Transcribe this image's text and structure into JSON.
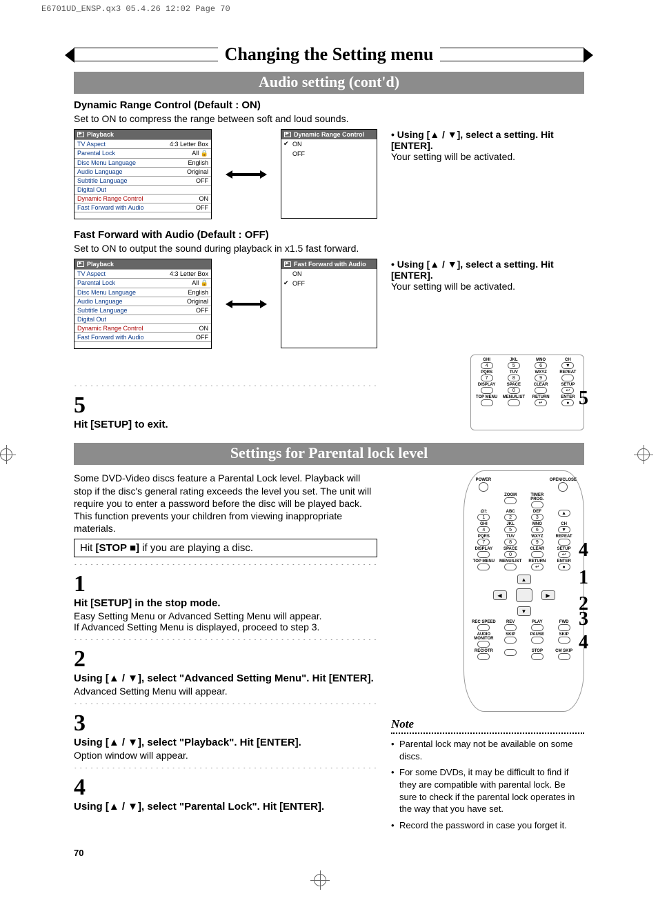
{
  "meta": {
    "header": "E6701UD_ENSP.qx3  05.4.26 12:02  Page 70"
  },
  "title": "Changing the Setting menu",
  "section1": {
    "bar": "Audio setting (cont'd)",
    "drc": {
      "heading": "Dynamic Range Control (Default : ON)",
      "desc": "Set to ON to compress the range between soft and loud sounds.",
      "menuTitle1": "Playback",
      "rows": [
        {
          "label": "TV Aspect",
          "value": "4:3 Letter Box",
          "hl": false
        },
        {
          "label": "Parental Lock",
          "value": "All  🔒",
          "hl": false
        },
        {
          "label": "Disc Menu Language",
          "value": "English",
          "hl": false
        },
        {
          "label": "Audio Language",
          "value": "Original",
          "hl": false
        },
        {
          "label": "Subtitle Language",
          "value": "OFF",
          "hl": false
        },
        {
          "label": "Digital Out",
          "value": "",
          "hl": false
        },
        {
          "label": "Dynamic Range Control",
          "value": "ON",
          "hl": true
        },
        {
          "label": "Fast Forward with Audio",
          "value": "OFF",
          "hl": false
        }
      ],
      "menuTitle2": "Dynamic Range Control",
      "options": [
        {
          "label": "ON",
          "checked": true
        },
        {
          "label": "OFF",
          "checked": false
        }
      ],
      "note1": "Using [▲ / ▼], select a setting. Hit [ENTER].",
      "note2": "Your setting will be activated."
    },
    "ffa": {
      "heading": "Fast Forward with Audio (Default : OFF)",
      "desc": "Set to ON to output the sound during playback in x1.5 fast forward.",
      "menuTitle1": "Playback",
      "rows": [
        {
          "label": "TV Aspect",
          "value": "4:3 Letter Box",
          "hl": false
        },
        {
          "label": "Parental Lock",
          "value": "All  🔒",
          "hl": false
        },
        {
          "label": "Disc Menu Language",
          "value": "English",
          "hl": false
        },
        {
          "label": "Audio Language",
          "value": "Original",
          "hl": false
        },
        {
          "label": "Subtitle Language",
          "value": "OFF",
          "hl": false
        },
        {
          "label": "Digital Out",
          "value": "",
          "hl": false
        },
        {
          "label": "Dynamic Range Control",
          "value": "ON",
          "hl": true
        },
        {
          "label": "Fast Forward with Audio",
          "value": "OFF",
          "hl": false
        }
      ],
      "menuTitle2": "Fast Forward with Audio",
      "options": [
        {
          "label": "ON",
          "checked": false
        },
        {
          "label": "OFF",
          "checked": true
        }
      ],
      "note1": "Using [▲ / ▼], select a setting. Hit [ENTER].",
      "note2": "Your setting will be activated."
    },
    "step5num": "5",
    "step5text": "Hit [SETUP] to exit.",
    "remoteCallout5": "5"
  },
  "section2": {
    "bar": "Settings for Parental lock level",
    "intro": "Some DVD-Video discs feature a Parental Lock level. Playback will stop if the disc's general rating exceeds the level you set. The unit will require you to enter a password before the disc will be played back. This function prevents your children from viewing inappropriate materials.",
    "boxInstrPrefix": "Hit ",
    "boxInstrBold": "[STOP ■]",
    "boxInstrSuffix": " if you are playing a disc.",
    "steps": [
      {
        "num": "1",
        "head": "Hit [SETUP] in the stop mode.",
        "body": "Easy Setting Menu or Advanced Setting Menu will appear.\nIf Advanced Setting Menu is displayed, proceed to step 3."
      },
      {
        "num": "2",
        "head": "Using [▲ / ▼], select \"Advanced Setting Menu\". Hit [ENTER].",
        "body": "Advanced Setting Menu will appear."
      },
      {
        "num": "3",
        "head": "Using [▲ / ▼], select \"Playback\". Hit [ENTER].",
        "body": "Option window will appear."
      },
      {
        "num": "4",
        "head": "Using [▲ / ▼], select \"Parental Lock\". Hit [ENTER].",
        "body": ""
      }
    ],
    "remoteCallouts": [
      "4",
      "1",
      "2",
      "3",
      "4"
    ],
    "noteHead": "Note",
    "notes": [
      "Parental lock may not be available on some discs.",
      "For some DVDs, it may be difficult to find if they are compatible with parental lock. Be sure to check if the parental lock operates in the way that you have set.",
      "Record the password in case you forget it."
    ]
  },
  "remoteSmall": {
    "row1": [
      "GHI",
      "JKL",
      "MNO",
      "CH"
    ],
    "btn1": [
      "4",
      "5",
      "6",
      "▼"
    ],
    "row2": [
      "PQRS",
      "TUV",
      "WXYZ",
      "REPEAT"
    ],
    "btn2": [
      "7",
      "8",
      "9",
      ""
    ],
    "row3": [
      "DISPLAY",
      "SPACE",
      "CLEAR",
      "SETUP"
    ],
    "btn3": [
      "",
      "0",
      "",
      "↩"
    ],
    "row4": [
      "TOP MENU",
      "MENU/LIST",
      "RETURN",
      "ENTER"
    ],
    "btn4": [
      "",
      "",
      "↵",
      "●"
    ]
  },
  "remoteBig": {
    "topRow": [
      "POWER",
      "",
      "",
      "OPEN/CLOSE"
    ],
    "topRow2": [
      "",
      "ZOOM",
      "TIMER PROG.",
      ""
    ],
    "numRows": [
      {
        "labels": [
          "@!:",
          "ABC",
          "DEF",
          ""
        ],
        "nums": [
          "1",
          "2",
          "3",
          "▲"
        ]
      },
      {
        "labels": [
          "GHI",
          "JKL",
          "MNO",
          "CH"
        ],
        "nums": [
          "4",
          "5",
          "6",
          "▼"
        ]
      },
      {
        "labels": [
          "PQRS",
          "TUV",
          "WXYZ",
          "REPEAT"
        ],
        "nums": [
          "7",
          "8",
          "9",
          ""
        ]
      },
      {
        "labels": [
          "DISPLAY",
          "SPACE",
          "CLEAR",
          "SETUP"
        ],
        "nums": [
          "",
          "0",
          "",
          "↩"
        ]
      },
      {
        "labels": [
          "TOP MENU",
          "MENU/LIST",
          "RETURN",
          "ENTER"
        ],
        "nums": [
          "",
          "",
          "↵",
          "●"
        ]
      }
    ],
    "bottomRows": [
      {
        "labels": [
          "REC SPEED",
          "REV",
          "PLAY",
          "FWD"
        ]
      },
      {
        "labels": [
          "AUDIO MONITOR",
          "SKIP",
          "PAUSE",
          "SKIP"
        ]
      },
      {
        "labels": [
          "REC/OTR",
          "",
          "STOP",
          "CM SKIP"
        ]
      }
    ]
  },
  "pageNum": "70"
}
